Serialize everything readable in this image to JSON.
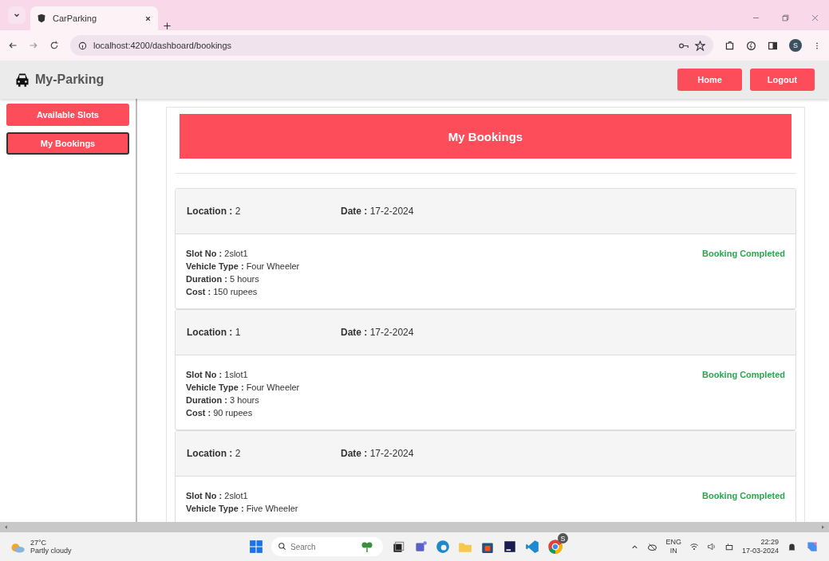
{
  "browser": {
    "tabs": [
      {
        "title": "CarParking",
        "selected": true
      }
    ],
    "url": "localhost:4200/dashboard/bookings",
    "profile_initial": "S"
  },
  "header": {
    "brand": "My-Parking",
    "buttons": [
      "Home",
      "Logout"
    ]
  },
  "sidebar": {
    "items": [
      {
        "label": "Available Slots",
        "selected": false
      },
      {
        "label": "My Bookings",
        "selected": true
      }
    ]
  },
  "page_title": "My Bookings",
  "bookings": [
    {
      "location": {
        "label": "Location :",
        "value": "2"
      },
      "date": {
        "label": "Date :",
        "value": "17-2-2024"
      },
      "status": "Booking Completed",
      "details": [
        {
          "label": "Slot No :",
          "value": "2slot1"
        },
        {
          "label": "Vehicle Type :",
          "value": "Four Wheeler"
        },
        {
          "label": "Duration :",
          "value": "5 hours"
        },
        {
          "label": "Cost :",
          "value": "150 rupees"
        }
      ]
    },
    {
      "location": {
        "label": "Location :",
        "value": "1"
      },
      "date": {
        "label": "Date :",
        "value": "17-2-2024"
      },
      "status": "Booking Completed",
      "details": [
        {
          "label": "Slot No :",
          "value": "1slot1"
        },
        {
          "label": "Vehicle Type :",
          "value": "Four Wheeler"
        },
        {
          "label": "Duration :",
          "value": "3 hours"
        },
        {
          "label": "Cost :",
          "value": "90 rupees"
        }
      ]
    },
    {
      "location": {
        "label": "Location :",
        "value": "2"
      },
      "date": {
        "label": "Date :",
        "value": "17-2-2024"
      },
      "status": "Booking Completed",
      "details": [
        {
          "label": "Slot No :",
          "value": "2slot1"
        },
        {
          "label": "Vehicle Type :",
          "value": "Five Wheeler"
        }
      ]
    }
  ],
  "taskbar": {
    "weather": {
      "temp": "27°C",
      "desc": "Partly cloudy"
    },
    "search_placeholder": "Search",
    "chrome_badge": "S",
    "language": [
      "ENG",
      "IN"
    ],
    "time": "22:29",
    "date": "17-03-2024"
  }
}
